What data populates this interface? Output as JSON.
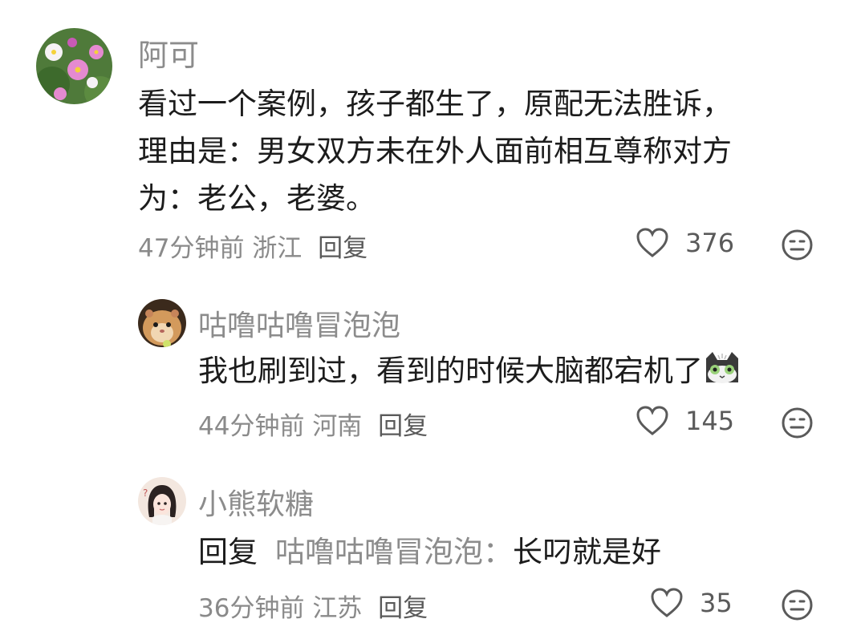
{
  "comments": [
    {
      "user": "阿可",
      "text_lines": [
        "看过一个案例，孩子都生了，原配无法胜诉，",
        "理由是：男女双方未在外人面前相互尊称对方",
        "为：老公，老婆。"
      ],
      "time": "47分钟前",
      "location": "浙江",
      "reply_label": "回复",
      "likes": "376",
      "avatar_icon": "cosmos-flower-avatar",
      "like_icon": "heart-outline-icon",
      "dislike_icon": "dislike-face-icon"
    },
    {
      "user": "咕噜咕噜冒泡泡",
      "text": "我也刷到过，看到的时候大脑都宕机了",
      "emoji": "cat-face-emoji",
      "time": "44分钟前",
      "location": "河南",
      "reply_label": "回复",
      "likes": "145",
      "avatar_icon": "hamster-avatar"
    },
    {
      "user": "小熊软糖",
      "reply_prefix": "回复",
      "mention": "咕噜咕噜冒泡泡：",
      "text": "长叼就是好",
      "time": "36分钟前",
      "location": "江苏",
      "reply_label": "回复",
      "likes": "35",
      "avatar_icon": "anime-girl-avatar"
    }
  ],
  "colors": {
    "name": "#8c8c8c",
    "text": "#1c1c1c",
    "meta": "#8a8a8a",
    "icon": "#5a5a5a"
  }
}
